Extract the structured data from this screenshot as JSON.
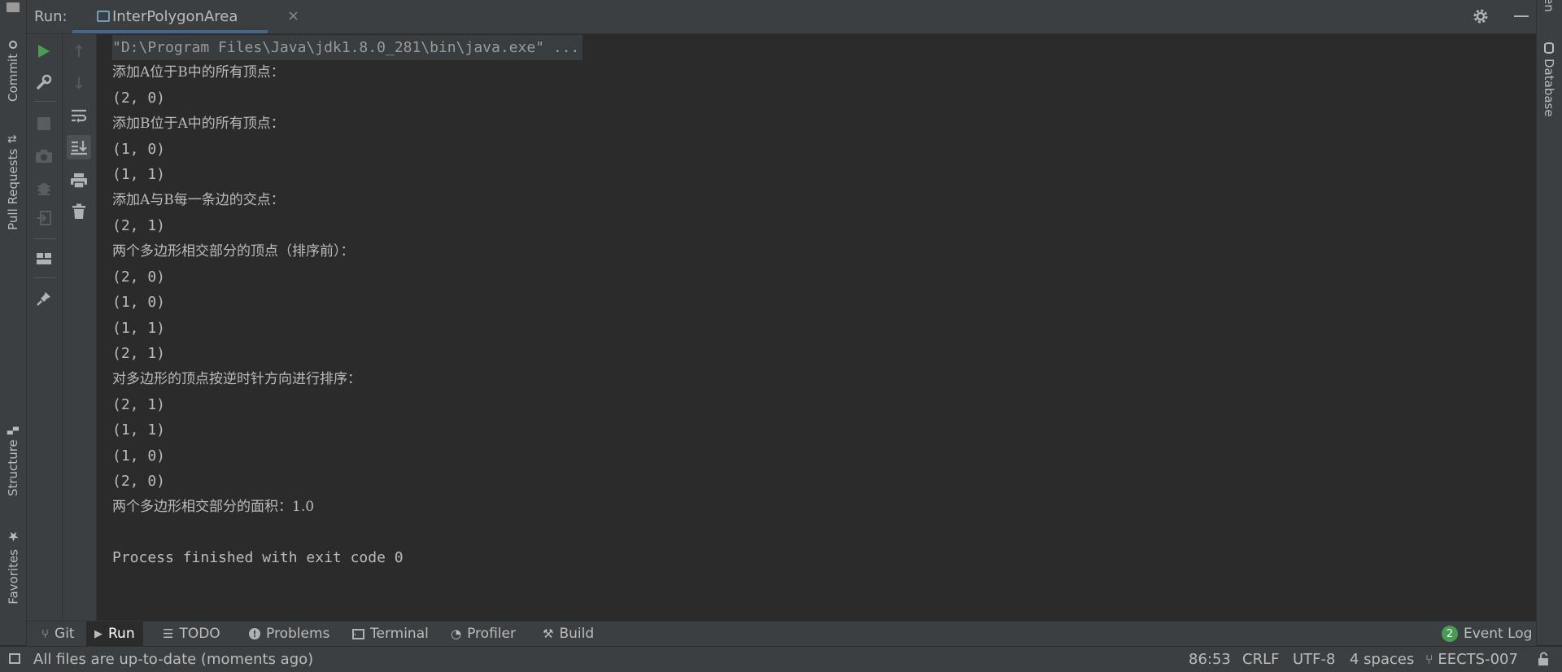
{
  "header": {
    "run_label": "Run:",
    "tab_label": "InterPolygonArea"
  },
  "left_stripe": {
    "commit": "Commit",
    "pull_requests": "Pull Requests",
    "structure": "Structure",
    "favorites": "Favorites"
  },
  "right_stripe": {
    "top_partial": "en",
    "database": "Database"
  },
  "console": {
    "command": "\"D:\\Program Files\\Java\\jdk1.8.0_281\\bin\\java.exe\" ...",
    "lines": [
      "添加A位于B中的所有顶点：",
      "(2, 0)",
      "添加B位于A中的所有顶点：",
      "(1, 0)",
      "(1, 1)",
      "添加A与B每一条边的交点：",
      "(2, 1)",
      "两个多边形相交部分的顶点（排序前）：",
      "(2, 0)",
      "(1, 0)",
      "(1, 1)",
      "(2, 1)",
      "对多边形的顶点按逆时针方向进行排序：",
      "(2, 1)",
      "(1, 1)",
      "(1, 0)",
      "(2, 0)",
      "两个多边形相交部分的面积：1.0",
      "",
      "Process finished with exit code 0"
    ]
  },
  "bottom_tabs": {
    "git": "Git",
    "run": "Run",
    "todo": "TODO",
    "problems": "Problems",
    "terminal": "Terminal",
    "profiler": "Profiler",
    "build": "Build",
    "event_log": "Event Log",
    "event_count": "2"
  },
  "status": {
    "message": "All files are up-to-date (moments ago)",
    "position": "86:53",
    "line_sep": "CRLF",
    "encoding": "UTF-8",
    "indent": "4 spaces",
    "branch": "EECTS-007"
  },
  "colors": {
    "run_green": "#499c54",
    "accent_blue": "#4a88c7"
  }
}
